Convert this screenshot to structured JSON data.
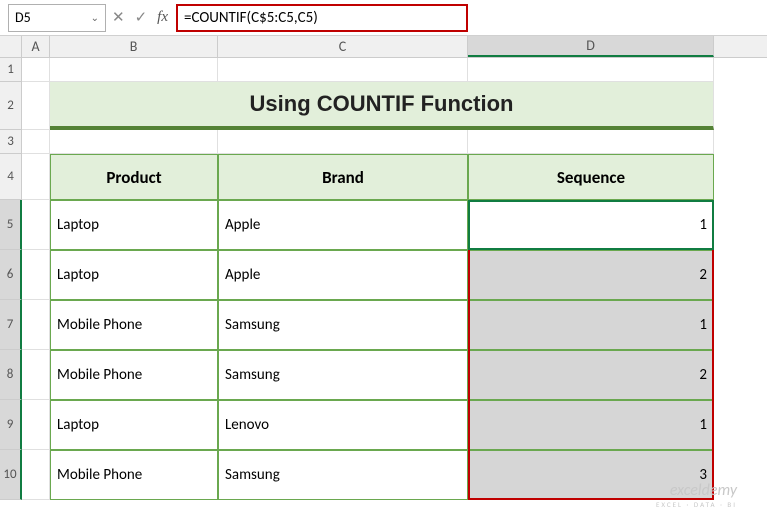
{
  "name_box": "D5",
  "fx_label": "fx",
  "formula": "=COUNTIF(C$5:C5,C5)",
  "columns": {
    "A": "A",
    "B": "B",
    "C": "C",
    "D": "D"
  },
  "title": "Using COUNTIF Function",
  "headers": {
    "product": "Product",
    "brand": "Brand",
    "sequence": "Sequence"
  },
  "rows": [
    {
      "n": "1"
    },
    {
      "n": "2"
    },
    {
      "n": "3"
    },
    {
      "n": "4"
    },
    {
      "n": "5",
      "product": "Laptop",
      "brand": "Apple",
      "seq": "1"
    },
    {
      "n": "6",
      "product": "Laptop",
      "brand": "Apple",
      "seq": "2"
    },
    {
      "n": "7",
      "product": "Mobile Phone",
      "brand": "Samsung",
      "seq": "1"
    },
    {
      "n": "8",
      "product": "Mobile Phone",
      "brand": "Samsung",
      "seq": "2"
    },
    {
      "n": "9",
      "product": "Laptop",
      "brand": "Lenovo",
      "seq": "1"
    },
    {
      "n": "10",
      "product": "Mobile Phone",
      "brand": "Samsung",
      "seq": "3"
    }
  ],
  "watermark": {
    "main": "exceldemy",
    "sub": "EXCEL · DATA · BI"
  },
  "icons": {
    "cancel": "✕",
    "confirm": "✓",
    "chevron": "⌄"
  },
  "chart_data": {
    "type": "table",
    "title": "Using COUNTIF Function",
    "columns": [
      "Product",
      "Brand",
      "Sequence"
    ],
    "rows": [
      [
        "Laptop",
        "Apple",
        1
      ],
      [
        "Laptop",
        "Apple",
        2
      ],
      [
        "Mobile Phone",
        "Samsung",
        1
      ],
      [
        "Mobile Phone",
        "Samsung",
        2
      ],
      [
        "Laptop",
        "Lenovo",
        1
      ],
      [
        "Mobile Phone",
        "Samsung",
        3
      ]
    ]
  }
}
